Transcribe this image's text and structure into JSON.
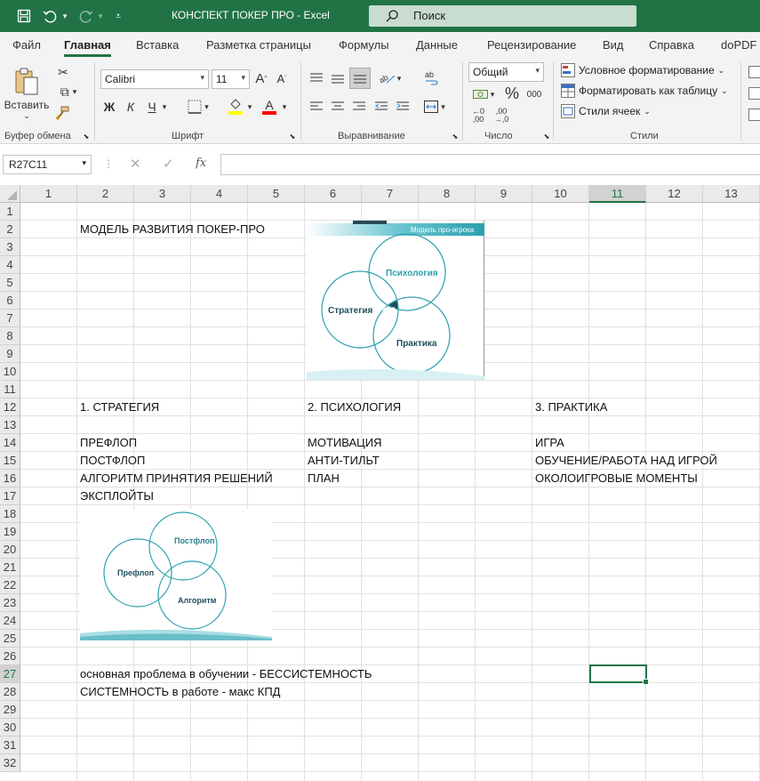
{
  "window": {
    "title": "КОНСПЕКТ ПОКЕР ПРО  -  Excel",
    "search_placeholder": "Поиск"
  },
  "tabs": [
    "Файл",
    "Главная",
    "Вставка",
    "Разметка страницы",
    "Формулы",
    "Данные",
    "Рецензирование",
    "Вид",
    "Справка",
    "doPDF"
  ],
  "ribbon": {
    "paste_label": "Вставить",
    "clipboard_label": "Буфер обмена",
    "font_name": "Calibri",
    "font_size": "11",
    "bold": "Ж",
    "italic": "К",
    "underline": "Ч",
    "font_group_label": "Шрифт",
    "align_group_label": "Выравнивание",
    "number_format": "Общий",
    "number_group_label": "Число",
    "cond_format": "Условное форматирование",
    "format_table": "Форматировать как таблицу",
    "cell_styles": "Стили ячеек",
    "styles_group_label": "Стили",
    "fill_color": "#ffff00",
    "font_color": "#ff0000"
  },
  "formula_bar": {
    "name_box": "R27C11",
    "fx": "fx",
    "content": ""
  },
  "columns": [
    "1",
    "2",
    "3",
    "4",
    "5",
    "6",
    "7",
    "8",
    "9",
    "10",
    "11",
    "12",
    "13"
  ],
  "rows": [
    "1",
    "2",
    "3",
    "4",
    "5",
    "6",
    "7",
    "8",
    "9",
    "10",
    "11",
    "12",
    "13",
    "14",
    "15",
    "16",
    "17",
    "18",
    "19",
    "20",
    "21",
    "22",
    "23",
    "24",
    "25",
    "26",
    "27",
    "28",
    "29",
    "30",
    "31",
    "32"
  ],
  "cells": {
    "r2c2": "МОДЕЛЬ РАЗВИТИЯ ПОКЕР-ПРО",
    "r12c2": "1. СТРАТЕГИЯ",
    "r12c6": "2. ПСИХОЛОГИЯ",
    "r12c10": "3. ПРАКТИКА",
    "r14c2": "ПРЕФЛОП",
    "r14c6": "МОТИВАЦИЯ",
    "r14c10": "ИГРА",
    "r15c2": "ПОСТФЛОП",
    "r15c6": "АНТИ-ТИЛЬТ",
    "r15c10": "ОБУЧЕНИЕ/РАБОТА НАД ИГРОЙ",
    "r16c2": "АЛГОРИТМ ПРИНЯТИЯ РЕШЕНИЙ",
    "r16c6": "ПЛАН",
    "r16c10": "ОКОЛОИГРОВЫЕ МОМЕНТЫ",
    "r17c2": "ЭКСПЛОЙТЫ",
    "r27c2": "основная проблема в обучении - БЕССИСТЕМНОСТЬ",
    "r28c2": "СИСТЕМНОСТЬ в работе - макс КПД"
  },
  "image1": {
    "header": "Модель про-игрока",
    "strategy": "Стратегия",
    "psychology": "Психология",
    "practice": "Практика",
    "center": "$$$",
    "accent": "#2a9fae"
  },
  "image2": {
    "preflop": "Префлоп",
    "postflop": "Постфлоп",
    "algorithm": "Алгоритм",
    "accent": "#2a9fae"
  }
}
